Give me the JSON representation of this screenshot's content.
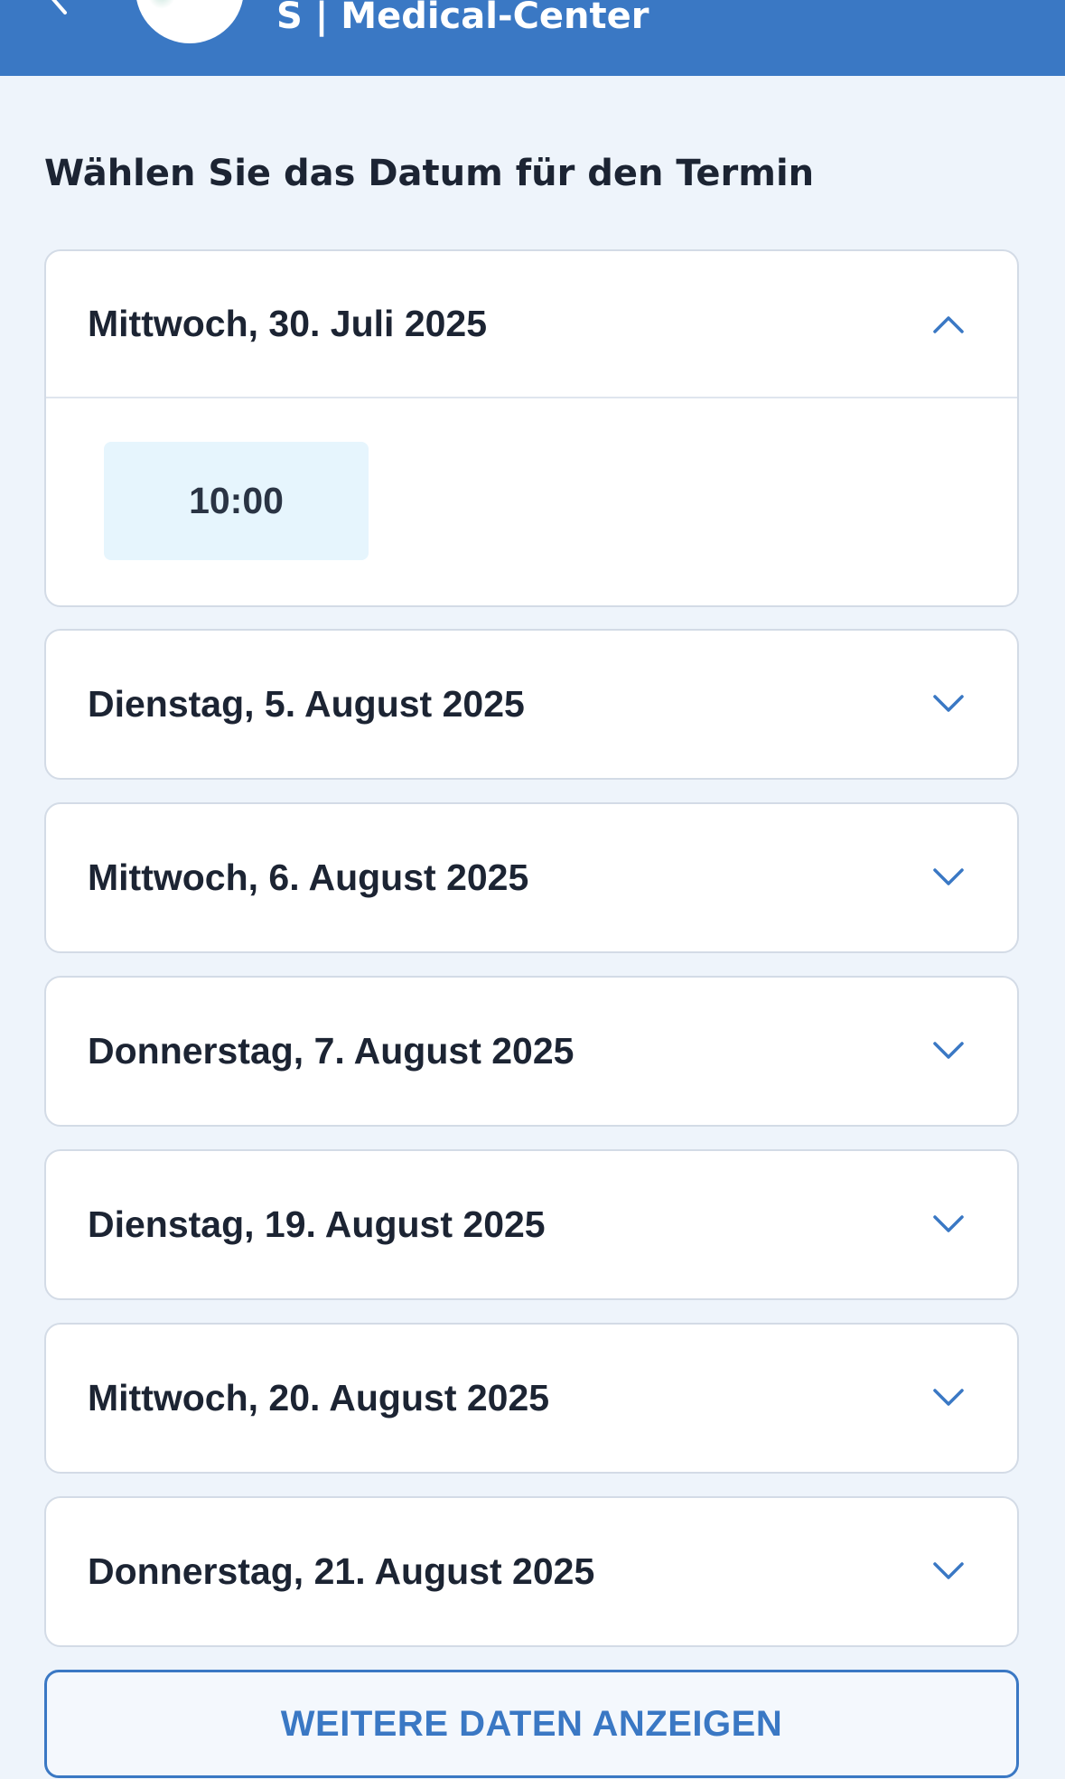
{
  "header": {
    "brand_name": "S | Medical-Center",
    "back_icon": "chevron-left-icon",
    "color": "#3a78c4"
  },
  "page_title": "Wählen Sie das Datum für den Termin",
  "dates": [
    {
      "label": "Mittwoch, 30. Juli 2025",
      "expanded": true,
      "icon": "chevron-up-icon",
      "times": [
        "10:00"
      ]
    },
    {
      "label": "Dienstag, 5. August 2025",
      "expanded": false,
      "icon": "chevron-down-icon"
    },
    {
      "label": "Mittwoch, 6. August 2025",
      "expanded": false,
      "icon": "chevron-down-icon"
    },
    {
      "label": "Donnerstag, 7. August 2025",
      "expanded": false,
      "icon": "chevron-down-icon"
    },
    {
      "label": "Dienstag, 19. August 2025",
      "expanded": false,
      "icon": "chevron-down-icon"
    },
    {
      "label": "Mittwoch, 20. August 2025",
      "expanded": false,
      "icon": "chevron-down-icon"
    },
    {
      "label": "Donnerstag, 21. August 2025",
      "expanded": false,
      "icon": "chevron-down-icon"
    }
  ],
  "more_button": {
    "label": "WEITERE DATEN ANZEIGEN"
  },
  "colors": {
    "accent": "#3a78c4",
    "background": "#eef4fb",
    "slot_background": "#e6f5fd",
    "text": "#1c2433"
  }
}
